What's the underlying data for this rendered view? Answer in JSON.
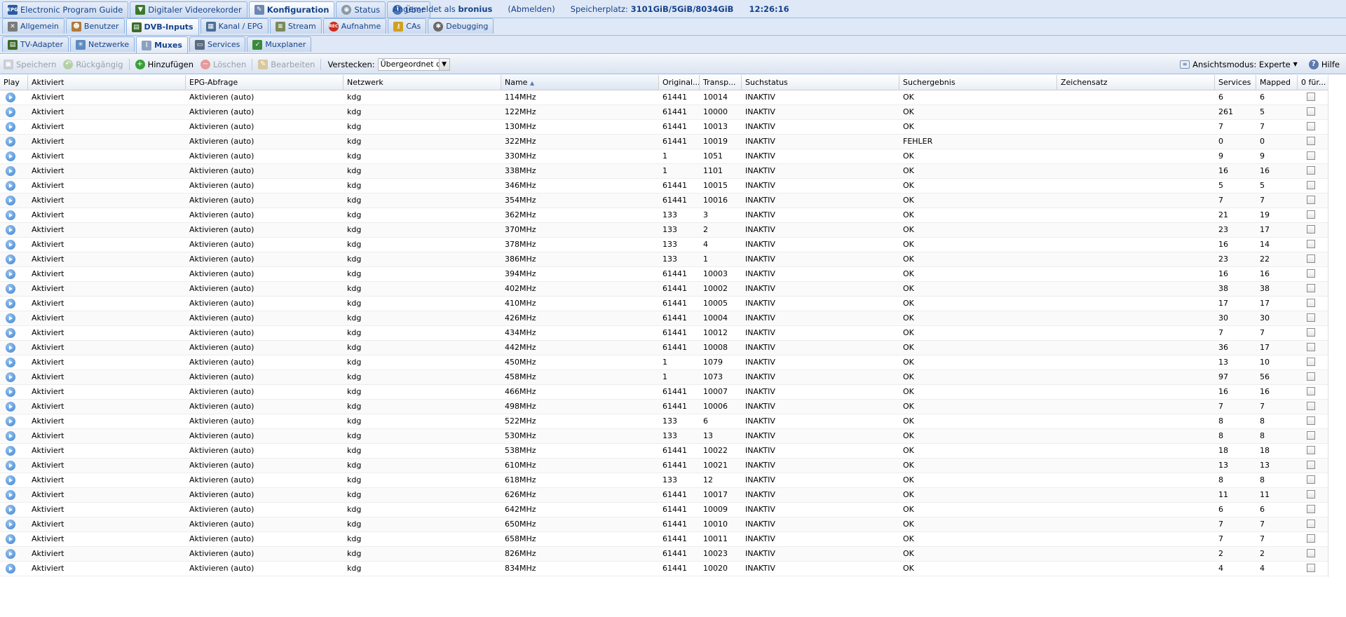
{
  "top_tabs": [
    {
      "label": "Electronic Program Guide",
      "icon": "epg-icon"
    },
    {
      "label": "Digitaler Videorekorder",
      "icon": "dvr-icon"
    },
    {
      "label": "Konfiguration",
      "icon": "wrench-icon"
    },
    {
      "label": "Status",
      "icon": "eye-icon"
    },
    {
      "label": "Über",
      "icon": "info-icon"
    }
  ],
  "session": {
    "logged_in_prefix": "Angemeldet als",
    "user": "bronius",
    "logout": "(Abmelden)",
    "storage_label": "Speicherplatz:",
    "storage_value": "3101GiB/5GiB/8034GiB",
    "time": "12:26:16"
  },
  "config_tabs": [
    {
      "label": "Allgemein",
      "icon": "tools-icon"
    },
    {
      "label": "Benutzer",
      "icon": "users-icon"
    },
    {
      "label": "DVB-Inputs",
      "icon": "tv-card-icon"
    },
    {
      "label": "Kanal / EPG",
      "icon": "channel-icon"
    },
    {
      "label": "Stream",
      "icon": "stream-icon"
    },
    {
      "label": "Aufnahme",
      "icon": "rec-icon"
    },
    {
      "label": "CAs",
      "icon": "key-icon"
    },
    {
      "label": "Debugging",
      "icon": "bug-icon"
    }
  ],
  "dvb_tabs": [
    {
      "label": "TV-Adapter",
      "icon": "adapter-icon"
    },
    {
      "label": "Netzwerke",
      "icon": "network-icon"
    },
    {
      "label": "Muxes",
      "icon": "mux-icon"
    },
    {
      "label": "Services",
      "icon": "services-icon"
    },
    {
      "label": "Muxplaner",
      "icon": "scheduler-icon"
    }
  ],
  "toolbar": {
    "save": "Speichern",
    "undo": "Rückgängig",
    "add": "Hinzufügen",
    "delete": "Löschen",
    "edit": "Bearbeiten",
    "hide_label": "Verstecken:",
    "hide_value": "Übergeordnet d",
    "view_mode": "Ansichtsmodus: Experte",
    "help": "Hilfe"
  },
  "columns": [
    "Play",
    "Aktiviert",
    "EPG-Abfrage",
    "Netzwerk",
    "Name",
    "Original...",
    "Transp...",
    "Suchstatus",
    "Suchergebnis",
    "Zeichensatz",
    "Services",
    "Mapped",
    "0 für..."
  ],
  "rows": [
    [
      "Aktiviert",
      "Aktivieren (auto)",
      "kdg",
      "114MHz",
      "61441",
      "10014",
      "INAKTIV",
      "OK",
      "",
      "6",
      "6"
    ],
    [
      "Aktiviert",
      "Aktivieren (auto)",
      "kdg",
      "122MHz",
      "61441",
      "10000",
      "INAKTIV",
      "OK",
      "",
      "261",
      "5"
    ],
    [
      "Aktiviert",
      "Aktivieren (auto)",
      "kdg",
      "130MHz",
      "61441",
      "10013",
      "INAKTIV",
      "OK",
      "",
      "7",
      "7"
    ],
    [
      "Aktiviert",
      "Aktivieren (auto)",
      "kdg",
      "322MHz",
      "61441",
      "10019",
      "INAKTIV",
      "FEHLER",
      "",
      "0",
      "0"
    ],
    [
      "Aktiviert",
      "Aktivieren (auto)",
      "kdg",
      "330MHz",
      "1",
      "1051",
      "INAKTIV",
      "OK",
      "",
      "9",
      "9"
    ],
    [
      "Aktiviert",
      "Aktivieren (auto)",
      "kdg",
      "338MHz",
      "1",
      "1101",
      "INAKTIV",
      "OK",
      "",
      "16",
      "16"
    ],
    [
      "Aktiviert",
      "Aktivieren (auto)",
      "kdg",
      "346MHz",
      "61441",
      "10015",
      "INAKTIV",
      "OK",
      "",
      "5",
      "5"
    ],
    [
      "Aktiviert",
      "Aktivieren (auto)",
      "kdg",
      "354MHz",
      "61441",
      "10016",
      "INAKTIV",
      "OK",
      "",
      "7",
      "7"
    ],
    [
      "Aktiviert",
      "Aktivieren (auto)",
      "kdg",
      "362MHz",
      "133",
      "3",
      "INAKTIV",
      "OK",
      "",
      "21",
      "19"
    ],
    [
      "Aktiviert",
      "Aktivieren (auto)",
      "kdg",
      "370MHz",
      "133",
      "2",
      "INAKTIV",
      "OK",
      "",
      "23",
      "17"
    ],
    [
      "Aktiviert",
      "Aktivieren (auto)",
      "kdg",
      "378MHz",
      "133",
      "4",
      "INAKTIV",
      "OK",
      "",
      "16",
      "14"
    ],
    [
      "Aktiviert",
      "Aktivieren (auto)",
      "kdg",
      "386MHz",
      "133",
      "1",
      "INAKTIV",
      "OK",
      "",
      "23",
      "22"
    ],
    [
      "Aktiviert",
      "Aktivieren (auto)",
      "kdg",
      "394MHz",
      "61441",
      "10003",
      "INAKTIV",
      "OK",
      "",
      "16",
      "16"
    ],
    [
      "Aktiviert",
      "Aktivieren (auto)",
      "kdg",
      "402MHz",
      "61441",
      "10002",
      "INAKTIV",
      "OK",
      "",
      "38",
      "38"
    ],
    [
      "Aktiviert",
      "Aktivieren (auto)",
      "kdg",
      "410MHz",
      "61441",
      "10005",
      "INAKTIV",
      "OK",
      "",
      "17",
      "17"
    ],
    [
      "Aktiviert",
      "Aktivieren (auto)",
      "kdg",
      "426MHz",
      "61441",
      "10004",
      "INAKTIV",
      "OK",
      "",
      "30",
      "30"
    ],
    [
      "Aktiviert",
      "Aktivieren (auto)",
      "kdg",
      "434MHz",
      "61441",
      "10012",
      "INAKTIV",
      "OK",
      "",
      "7",
      "7"
    ],
    [
      "Aktiviert",
      "Aktivieren (auto)",
      "kdg",
      "442MHz",
      "61441",
      "10008",
      "INAKTIV",
      "OK",
      "",
      "36",
      "17"
    ],
    [
      "Aktiviert",
      "Aktivieren (auto)",
      "kdg",
      "450MHz",
      "1",
      "1079",
      "INAKTIV",
      "OK",
      "",
      "13",
      "10"
    ],
    [
      "Aktiviert",
      "Aktivieren (auto)",
      "kdg",
      "458MHz",
      "1",
      "1073",
      "INAKTIV",
      "OK",
      "",
      "97",
      "56"
    ],
    [
      "Aktiviert",
      "Aktivieren (auto)",
      "kdg",
      "466MHz",
      "61441",
      "10007",
      "INAKTIV",
      "OK",
      "",
      "16",
      "16"
    ],
    [
      "Aktiviert",
      "Aktivieren (auto)",
      "kdg",
      "498MHz",
      "61441",
      "10006",
      "INAKTIV",
      "OK",
      "",
      "7",
      "7"
    ],
    [
      "Aktiviert",
      "Aktivieren (auto)",
      "kdg",
      "522MHz",
      "133",
      "6",
      "INAKTIV",
      "OK",
      "",
      "8",
      "8"
    ],
    [
      "Aktiviert",
      "Aktivieren (auto)",
      "kdg",
      "530MHz",
      "133",
      "13",
      "INAKTIV",
      "OK",
      "",
      "8",
      "8"
    ],
    [
      "Aktiviert",
      "Aktivieren (auto)",
      "kdg",
      "538MHz",
      "61441",
      "10022",
      "INAKTIV",
      "OK",
      "",
      "18",
      "18"
    ],
    [
      "Aktiviert",
      "Aktivieren (auto)",
      "kdg",
      "610MHz",
      "61441",
      "10021",
      "INAKTIV",
      "OK",
      "",
      "13",
      "13"
    ],
    [
      "Aktiviert",
      "Aktivieren (auto)",
      "kdg",
      "618MHz",
      "133",
      "12",
      "INAKTIV",
      "OK",
      "",
      "8",
      "8"
    ],
    [
      "Aktiviert",
      "Aktivieren (auto)",
      "kdg",
      "626MHz",
      "61441",
      "10017",
      "INAKTIV",
      "OK",
      "",
      "11",
      "11"
    ],
    [
      "Aktiviert",
      "Aktivieren (auto)",
      "kdg",
      "642MHz",
      "61441",
      "10009",
      "INAKTIV",
      "OK",
      "",
      "6",
      "6"
    ],
    [
      "Aktiviert",
      "Aktivieren (auto)",
      "kdg",
      "650MHz",
      "61441",
      "10010",
      "INAKTIV",
      "OK",
      "",
      "7",
      "7"
    ],
    [
      "Aktiviert",
      "Aktivieren (auto)",
      "kdg",
      "658MHz",
      "61441",
      "10011",
      "INAKTIV",
      "OK",
      "",
      "7",
      "7"
    ],
    [
      "Aktiviert",
      "Aktivieren (auto)",
      "kdg",
      "826MHz",
      "61441",
      "10023",
      "INAKTIV",
      "OK",
      "",
      "2",
      "2"
    ],
    [
      "Aktiviert",
      "Aktivieren (auto)",
      "kdg",
      "834MHz",
      "61441",
      "10020",
      "INAKTIV",
      "OK",
      "",
      "4",
      "4"
    ]
  ]
}
